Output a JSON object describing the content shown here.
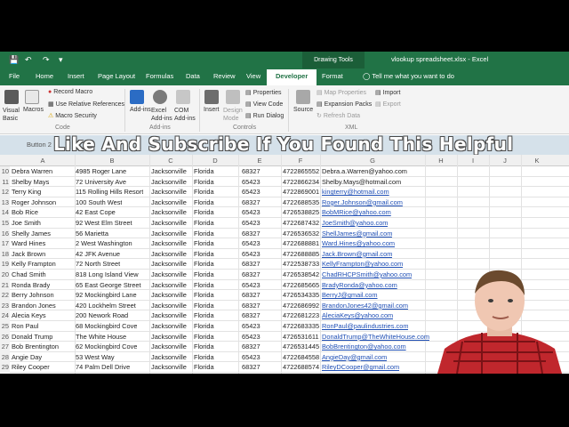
{
  "titlebar": {
    "context_tab": "Drawing Tools",
    "window_title": "vlookup spreadsheet.xlsx - Excel"
  },
  "tabs": [
    "File",
    "Home",
    "Insert",
    "Page Layout",
    "Formulas",
    "Data",
    "Review",
    "View",
    "Developer",
    "Format"
  ],
  "tell_me": "Tell me what you want to do",
  "ribbon": {
    "visual_basic": "Visual Basic",
    "macros": "Macros",
    "record_macro": "Record Macro",
    "relative_refs": "Use Relative References",
    "macro_security": "Macro Security",
    "group_code": "Code",
    "add_ins": "Add-ins",
    "excel_add_ins": "Excel Add-ins",
    "com_add_ins": "COM Add-ins",
    "group_add_ins": "Add-ins",
    "insert": "Insert",
    "design_mode": "Design Mode",
    "properties": "Properties",
    "view_code": "View Code",
    "run_dialog": "Run Dialog",
    "group_controls": "Controls",
    "source": "Source",
    "map_properties": "Map Properties",
    "expansion_packs": "Expansion Packs",
    "refresh_data": "Refresh Data",
    "import": "Import",
    "export": "Export",
    "group_xml": "XML"
  },
  "banner": "Like And Subscribe If You Found This Helpful",
  "name_box": "Button 2",
  "columns": [
    "A",
    "B",
    "C",
    "D",
    "E",
    "F",
    "G",
    "H",
    "I",
    "J",
    "K"
  ],
  "rows": [
    {
      "n": "10",
      "a": "Debra Warren",
      "b": "4985 Roger Lane",
      "c": "Jacksonville",
      "d": "Florida",
      "e": "68327",
      "f": "4722865552",
      "g": "Debra.a.Warren@yahoo.com",
      "link": false
    },
    {
      "n": "11",
      "a": "Shelby Mays",
      "b": "72 University Ave",
      "c": "Jacksonville",
      "d": "Florida",
      "e": "65423",
      "f": "4722866234",
      "g": "Shelby.Mays@hotmail.com",
      "link": false
    },
    {
      "n": "12",
      "a": "Terry King",
      "b": "115 Rolling Hills Resort",
      "c": "Jacksonville",
      "d": "Florida",
      "e": "65423",
      "f": "4722869001",
      "g": "kingterry@hotmail.com",
      "link": true
    },
    {
      "n": "13",
      "a": "Roger Johnson",
      "b": "100 South West",
      "c": "Jacksonville",
      "d": "Florida",
      "e": "68327",
      "f": "4722688535",
      "g": "Roger.Johnson@gmail.com",
      "link": true
    },
    {
      "n": "14",
      "a": "Bob Rice",
      "b": "42 East Cope",
      "c": "Jacksonville",
      "d": "Florida",
      "e": "65423",
      "f": "4726538825",
      "g": "BobMRice@yahoo.com",
      "link": true
    },
    {
      "n": "15",
      "a": "Joe Smith",
      "b": "92 West Elm Street",
      "c": "Jacksonville",
      "d": "Florida",
      "e": "65423",
      "f": "4722687432",
      "g": "JoeSmith@yahoo.com",
      "link": true
    },
    {
      "n": "16",
      "a": "Shelly James",
      "b": "56 Marietta",
      "c": "Jacksonville",
      "d": "Florida",
      "e": "68327",
      "f": "4726536532",
      "g": "ShellJames@gmail.com",
      "link": true
    },
    {
      "n": "17",
      "a": "Ward Hines",
      "b": "2 West Washington",
      "c": "Jacksonville",
      "d": "Florida",
      "e": "65423",
      "f": "4722688881",
      "g": "Ward.Hines@yahoo.com",
      "link": true
    },
    {
      "n": "18",
      "a": "Jack Brown",
      "b": "42 JFK Avenue",
      "c": "Jacksonville",
      "d": "Florida",
      "e": "65423",
      "f": "4722688885",
      "g": "Jack.Brown@gmail.com",
      "link": true
    },
    {
      "n": "19",
      "a": "Kelly Frampton",
      "b": "72 North Street",
      "c": "Jacksonville",
      "d": "Florida",
      "e": "68327",
      "f": "4722538733",
      "g": "KellyFrampton@yahoo.com",
      "link": true
    },
    {
      "n": "20",
      "a": "Chad Smith",
      "b": "818 Long Island View",
      "c": "Jacksonville",
      "d": "Florida",
      "e": "68327",
      "f": "4726538542",
      "g": "ChadRHCPSmith@yahoo.com",
      "link": true
    },
    {
      "n": "21",
      "a": "Ronda Brady",
      "b": "65 East George Street",
      "c": "Jacksonville",
      "d": "Florida",
      "e": "65423",
      "f": "4722685665",
      "g": "BradyRonda@yahoo.com",
      "link": true
    },
    {
      "n": "22",
      "a": "Berry Johnson",
      "b": "92 Mockingbird Lane",
      "c": "Jacksonville",
      "d": "Florida",
      "e": "68327",
      "f": "4726534335",
      "g": "BerryJ@gmail.com",
      "link": true
    },
    {
      "n": "23",
      "a": "Brandon Jones",
      "b": "420 Lockhelm Street",
      "c": "Jacksonville",
      "d": "Florida",
      "e": "68327",
      "f": "4722686992",
      "g": "BrandonJones42@gmail.com",
      "link": true
    },
    {
      "n": "24",
      "a": "Alecia Keys",
      "b": "200 Nework Road",
      "c": "Jacksonville",
      "d": "Florida",
      "e": "68327",
      "f": "4722681223",
      "g": "AleciaKeys@yahoo.com",
      "link": true
    },
    {
      "n": "25",
      "a": "Ron Paul",
      "b": "68 Mockingbird Cove",
      "c": "Jacksonville",
      "d": "Florida",
      "e": "65423",
      "f": "4722683335",
      "g": "RonPaul@paulindustries.com",
      "link": true
    },
    {
      "n": "26",
      "a": "Donald Trump",
      "b": "The White House",
      "c": "Jacksonville",
      "d": "Florida",
      "e": "65423",
      "f": "4726531611",
      "g": "DonaldTrump@TheWhiteHouse.com",
      "link": true
    },
    {
      "n": "27",
      "a": "Bob Brentington",
      "b": "62 Mockingbird Cove",
      "c": "Jacksonville",
      "d": "Florida",
      "e": "68327",
      "f": "4726531445",
      "g": "BobBrentington@yahoo.com",
      "link": true
    },
    {
      "n": "28",
      "a": "Angie Day",
      "b": "53 West Way",
      "c": "Jacksonville",
      "d": "Florida",
      "e": "65423",
      "f": "4722684558",
      "g": "AngieDay@gmail.com",
      "link": true
    },
    {
      "n": "29",
      "a": "Riley Cooper",
      "b": "74 Palm Dell Drive",
      "c": "Jacksonville",
      "d": "Florida",
      "e": "68327",
      "f": "4722688574",
      "g": "RileyDCooper@gmail.com",
      "link": true
    }
  ],
  "colors": {
    "excel_green": "#217346",
    "link_blue": "#1f4fb5",
    "banner_bg": "#cedce6"
  }
}
